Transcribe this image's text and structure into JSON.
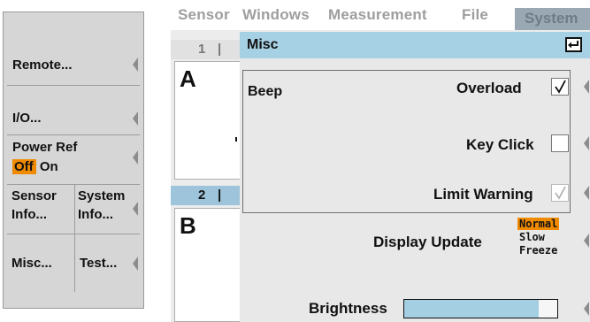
{
  "left_panel": {
    "remote_label": "Remote...",
    "io_label": "I/O...",
    "power_ref": {
      "title": "Power Ref",
      "off_label": "Off",
      "on_label": "On",
      "state": "Off"
    },
    "sensor_info": {
      "line1": "Sensor",
      "line2": "Info..."
    },
    "system_info": {
      "line1": "System",
      "line2": "Info..."
    },
    "misc_label": "Misc...",
    "test_label": "Test..."
  },
  "menu": {
    "items": [
      "Sensor",
      "Windows",
      "Measurement",
      "File"
    ],
    "active": "System"
  },
  "windows": {
    "tab1": {
      "number": "1",
      "sep": "|",
      "letter": "A"
    },
    "tab2": {
      "number": "2",
      "sep": "|",
      "letter": "B"
    }
  },
  "dialog": {
    "title": "Misc",
    "beep_label": "Beep",
    "overload": {
      "label": "Overload",
      "checked": true
    },
    "key_click": {
      "label": "Key Click",
      "checked": false
    },
    "limit_warning": {
      "label": "Limit Warning",
      "checked": true,
      "enabled": false
    },
    "display_update": {
      "label": "Display Update",
      "options": [
        "Normal",
        "Slow",
        "Freeze"
      ],
      "selected": "Normal"
    },
    "brightness": {
      "label": "Brightness",
      "value": 0.88
    }
  },
  "colors": {
    "accent_orange": "#f08a00",
    "dialog_title_blue": "#a6d0e3",
    "active_tab_blue": "#9dc4da",
    "system_menu_bg": "#9aa8b3"
  }
}
